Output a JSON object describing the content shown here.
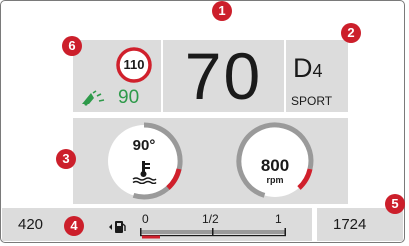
{
  "speed_limit": {
    "value": "110",
    "eco_speed": "90"
  },
  "speed": {
    "value": "70"
  },
  "gear": {
    "main": "D",
    "sub": "4",
    "mode": "SPORT"
  },
  "gauges": {
    "temperature": {
      "value": "90°",
      "fill_fraction": 0.2
    },
    "rpm": {
      "value": "800",
      "unit": "rpm",
      "fill_fraction": 0.2
    }
  },
  "trip": {
    "range": "420"
  },
  "fuel": {
    "scale_labels": [
      "0",
      "1/2",
      "1"
    ],
    "level_fraction": 0.12
  },
  "odometer": {
    "value": "1724"
  },
  "markers": [
    "1",
    "2",
    "3",
    "4",
    "5",
    "6"
  ],
  "colors": {
    "marker": "#cc1f2b",
    "eco": "#2e9a4a",
    "warning": "#d0202c",
    "panel": "#dcdcdc"
  }
}
